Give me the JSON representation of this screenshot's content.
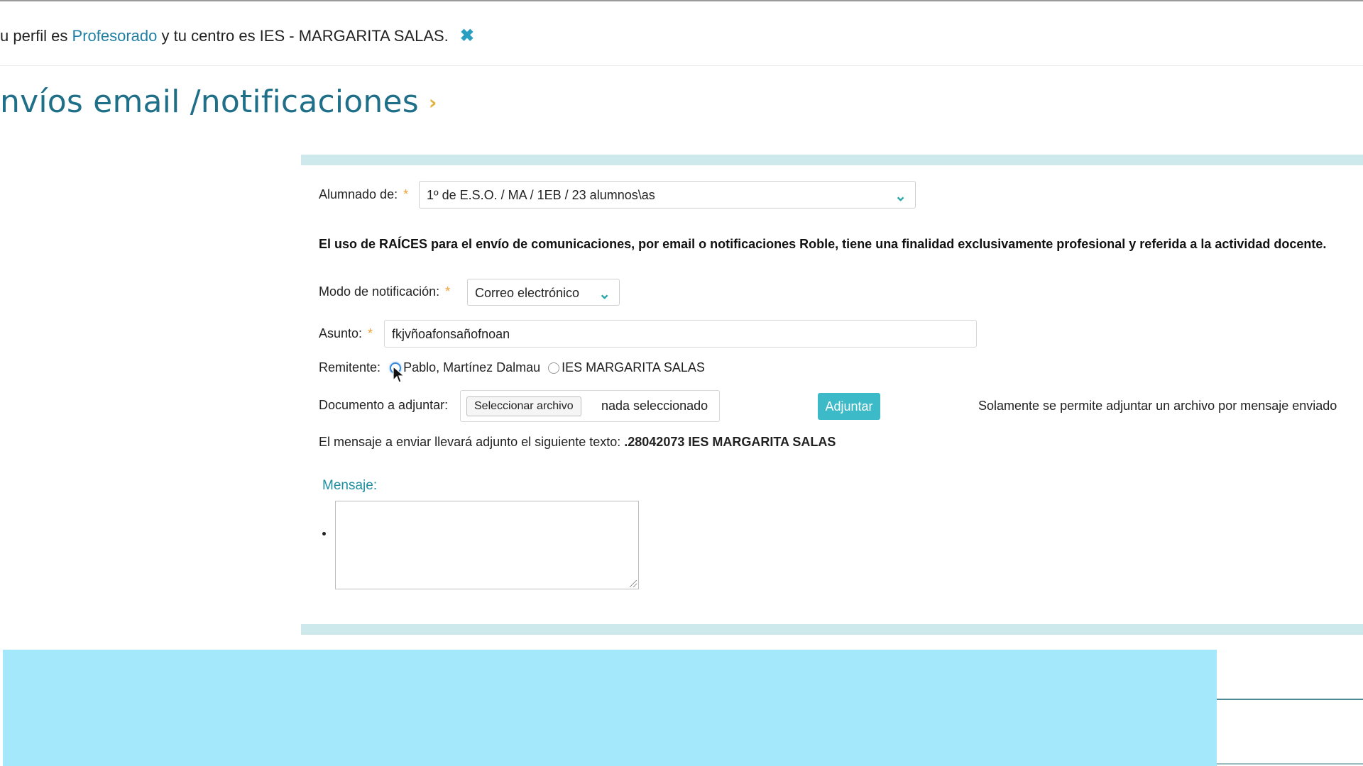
{
  "profile_bar": {
    "prefix": "u perfil es",
    "profile_link": "Profesorado",
    "middle": "y tu centro es IES - MARGARITA SALAS.",
    "close_icon": "close-x-icon"
  },
  "page": {
    "title": "nvíos email /notificaciones",
    "title_chevron": "›"
  },
  "form": {
    "alumnado_label": "Alumnado de:",
    "alumnado_value": "1º de E.S.O. / MA / 1EB / 23 alumnos\\as",
    "required_mark": "*",
    "notice": "El uso de RAÍCES para el envío de comunicaciones, por email o notificaciones Roble, tiene una finalidad exclusivamente profesional y referida a la actividad docente.",
    "modo_label": "Modo de notificación:",
    "modo_value": "Correo electrónico",
    "asunto_label": "Asunto:",
    "asunto_value": "fkjvñoafonsañofnoan",
    "remitente_label": "Remitente:",
    "remitente_options": [
      {
        "label": "Pablo, Martínez Dalmau",
        "checked": true
      },
      {
        "label": "IES MARGARITA SALAS",
        "checked": false
      }
    ],
    "documento_label": "Documento a adjuntar:",
    "file_button": "Seleccionar archivo",
    "file_status": "nada seleccionado",
    "attach_button": "Adjuntar",
    "attach_note": "Solamente se permite adjuntar un archivo por mensaje enviado",
    "appended_text_label": "El mensaje a enviar llevará adjunto el siguiente texto:",
    "appended_text_value": ".28042073 IES MARGARITA SALAS",
    "mensaje_label": "Mensaje:",
    "mensaje_value": ""
  },
  "colors": {
    "accent": "#1f6f89",
    "band": "#cde9ec",
    "button": "#3cbac8",
    "required": "#f0a030",
    "overlay": "#a4e8fb"
  }
}
